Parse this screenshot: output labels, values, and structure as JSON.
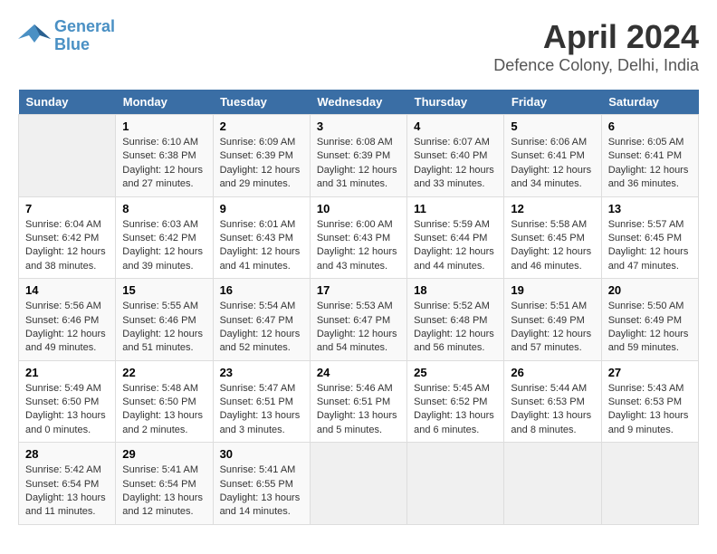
{
  "logo": {
    "line1": "General",
    "line2": "Blue"
  },
  "title": "April 2024",
  "subtitle": "Defence Colony, Delhi, India",
  "days_header": [
    "Sunday",
    "Monday",
    "Tuesday",
    "Wednesday",
    "Thursday",
    "Friday",
    "Saturday"
  ],
  "weeks": [
    [
      {
        "day": "",
        "info": ""
      },
      {
        "day": "1",
        "info": "Sunrise: 6:10 AM\nSunset: 6:38 PM\nDaylight: 12 hours\nand 27 minutes."
      },
      {
        "day": "2",
        "info": "Sunrise: 6:09 AM\nSunset: 6:39 PM\nDaylight: 12 hours\nand 29 minutes."
      },
      {
        "day": "3",
        "info": "Sunrise: 6:08 AM\nSunset: 6:39 PM\nDaylight: 12 hours\nand 31 minutes."
      },
      {
        "day": "4",
        "info": "Sunrise: 6:07 AM\nSunset: 6:40 PM\nDaylight: 12 hours\nand 33 minutes."
      },
      {
        "day": "5",
        "info": "Sunrise: 6:06 AM\nSunset: 6:41 PM\nDaylight: 12 hours\nand 34 minutes."
      },
      {
        "day": "6",
        "info": "Sunrise: 6:05 AM\nSunset: 6:41 PM\nDaylight: 12 hours\nand 36 minutes."
      }
    ],
    [
      {
        "day": "7",
        "info": "Sunrise: 6:04 AM\nSunset: 6:42 PM\nDaylight: 12 hours\nand 38 minutes."
      },
      {
        "day": "8",
        "info": "Sunrise: 6:03 AM\nSunset: 6:42 PM\nDaylight: 12 hours\nand 39 minutes."
      },
      {
        "day": "9",
        "info": "Sunrise: 6:01 AM\nSunset: 6:43 PM\nDaylight: 12 hours\nand 41 minutes."
      },
      {
        "day": "10",
        "info": "Sunrise: 6:00 AM\nSunset: 6:43 PM\nDaylight: 12 hours\nand 43 minutes."
      },
      {
        "day": "11",
        "info": "Sunrise: 5:59 AM\nSunset: 6:44 PM\nDaylight: 12 hours\nand 44 minutes."
      },
      {
        "day": "12",
        "info": "Sunrise: 5:58 AM\nSunset: 6:45 PM\nDaylight: 12 hours\nand 46 minutes."
      },
      {
        "day": "13",
        "info": "Sunrise: 5:57 AM\nSunset: 6:45 PM\nDaylight: 12 hours\nand 47 minutes."
      }
    ],
    [
      {
        "day": "14",
        "info": "Sunrise: 5:56 AM\nSunset: 6:46 PM\nDaylight: 12 hours\nand 49 minutes."
      },
      {
        "day": "15",
        "info": "Sunrise: 5:55 AM\nSunset: 6:46 PM\nDaylight: 12 hours\nand 51 minutes."
      },
      {
        "day": "16",
        "info": "Sunrise: 5:54 AM\nSunset: 6:47 PM\nDaylight: 12 hours\nand 52 minutes."
      },
      {
        "day": "17",
        "info": "Sunrise: 5:53 AM\nSunset: 6:47 PM\nDaylight: 12 hours\nand 54 minutes."
      },
      {
        "day": "18",
        "info": "Sunrise: 5:52 AM\nSunset: 6:48 PM\nDaylight: 12 hours\nand 56 minutes."
      },
      {
        "day": "19",
        "info": "Sunrise: 5:51 AM\nSunset: 6:49 PM\nDaylight: 12 hours\nand 57 minutes."
      },
      {
        "day": "20",
        "info": "Sunrise: 5:50 AM\nSunset: 6:49 PM\nDaylight: 12 hours\nand 59 minutes."
      }
    ],
    [
      {
        "day": "21",
        "info": "Sunrise: 5:49 AM\nSunset: 6:50 PM\nDaylight: 13 hours\nand 0 minutes."
      },
      {
        "day": "22",
        "info": "Sunrise: 5:48 AM\nSunset: 6:50 PM\nDaylight: 13 hours\nand 2 minutes."
      },
      {
        "day": "23",
        "info": "Sunrise: 5:47 AM\nSunset: 6:51 PM\nDaylight: 13 hours\nand 3 minutes."
      },
      {
        "day": "24",
        "info": "Sunrise: 5:46 AM\nSunset: 6:51 PM\nDaylight: 13 hours\nand 5 minutes."
      },
      {
        "day": "25",
        "info": "Sunrise: 5:45 AM\nSunset: 6:52 PM\nDaylight: 13 hours\nand 6 minutes."
      },
      {
        "day": "26",
        "info": "Sunrise: 5:44 AM\nSunset: 6:53 PM\nDaylight: 13 hours\nand 8 minutes."
      },
      {
        "day": "27",
        "info": "Sunrise: 5:43 AM\nSunset: 6:53 PM\nDaylight: 13 hours\nand 9 minutes."
      }
    ],
    [
      {
        "day": "28",
        "info": "Sunrise: 5:42 AM\nSunset: 6:54 PM\nDaylight: 13 hours\nand 11 minutes."
      },
      {
        "day": "29",
        "info": "Sunrise: 5:41 AM\nSunset: 6:54 PM\nDaylight: 13 hours\nand 12 minutes."
      },
      {
        "day": "30",
        "info": "Sunrise: 5:41 AM\nSunset: 6:55 PM\nDaylight: 13 hours\nand 14 minutes."
      },
      {
        "day": "",
        "info": ""
      },
      {
        "day": "",
        "info": ""
      },
      {
        "day": "",
        "info": ""
      },
      {
        "day": "",
        "info": ""
      }
    ]
  ]
}
